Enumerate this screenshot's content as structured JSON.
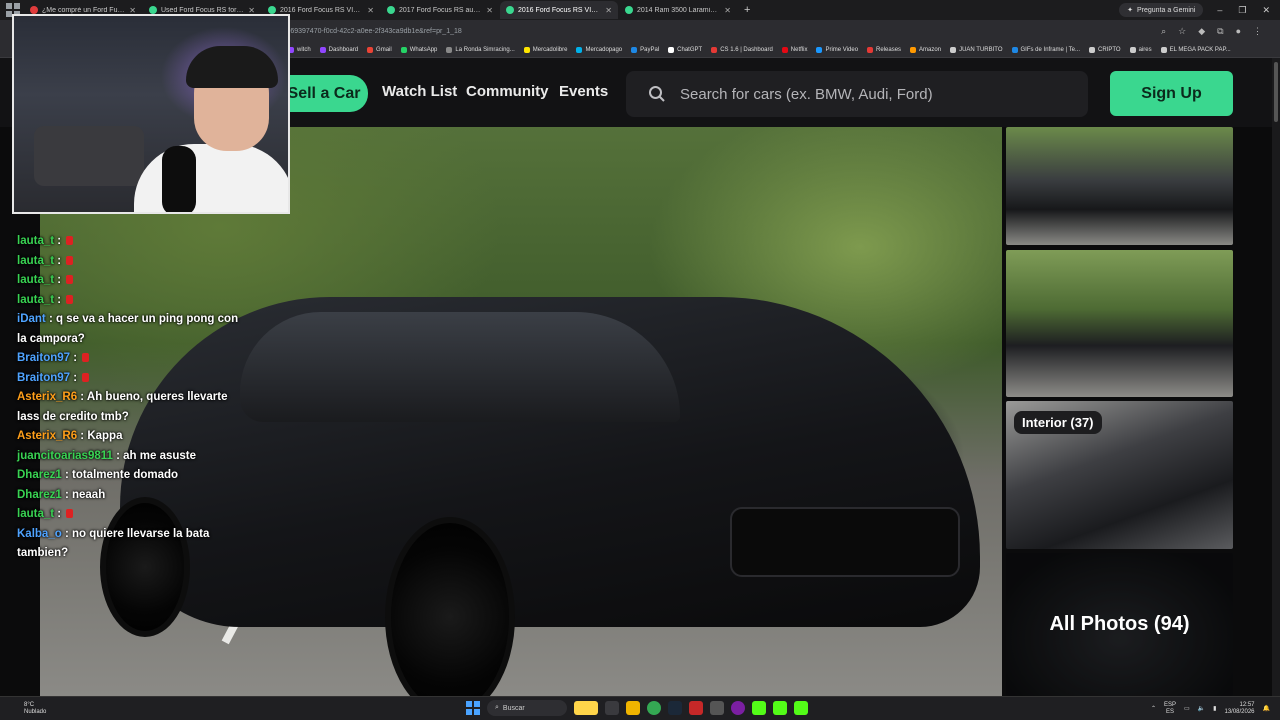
{
  "browser": {
    "tabs": [
      {
        "title": "¿Me compré un Ford Fusion Sp...",
        "color": "#e03c3c"
      },
      {
        "title": "Used Ford Focus RS for Sale -",
        "color": "#3ad78f"
      },
      {
        "title": "2016 Ford Focus RS VIN: WF0D...",
        "color": "#3ad78f"
      },
      {
        "title": "2017 Ford Focus RS auction - C...",
        "color": "#3ad78f"
      },
      {
        "title": "2016 Ford Focus RS VIN: WF0D...",
        "color": "#3ad78f",
        "active": true
      },
      {
        "title": "2014 Ram 3500 Laramie 4x4 V...",
        "color": "#3ad78f"
      }
    ],
    "new_tab": "+",
    "gemini": "Pregunta a Gemini",
    "url": "-69397470-f0cd-42c2-a0ee-2f343ca9db1e&ref=pr_1_18",
    "bookmarks": [
      {
        "label": "witch",
        "color": "#9146ff"
      },
      {
        "label": "Dashboard",
        "color": "#9146ff"
      },
      {
        "label": "Gmail",
        "color": "#ea4335"
      },
      {
        "label": "WhatsApp",
        "color": "#25d366"
      },
      {
        "label": "La Ronda Simracing...",
        "color": "#888888"
      },
      {
        "label": "Mercadolibre",
        "color": "#ffe600"
      },
      {
        "label": "Mercadopago",
        "color": "#00b1ea"
      },
      {
        "label": "PayPal",
        "color": "#1e88e5"
      },
      {
        "label": "ChatGPT",
        "color": "#ffffff"
      },
      {
        "label": "CS 1.6 | Dashboard",
        "color": "#e53935"
      },
      {
        "label": "Netflix",
        "color": "#e50914"
      },
      {
        "label": "Prime Video",
        "color": "#1a98ff"
      },
      {
        "label": "Releases",
        "color": "#e53935"
      },
      {
        "label": "Amazon",
        "color": "#ff9900"
      },
      {
        "label": "JUAN TURBITO",
        "color": "#cccccc"
      },
      {
        "label": "GIFs de Inframe | Te...",
        "color": "#1e88e5"
      },
      {
        "label": "CRIPTO",
        "color": "#cccccc"
      },
      {
        "label": "aires",
        "color": "#cccccc"
      },
      {
        "label": "EL MEGA PACK PAP...",
        "color": "#cccccc"
      }
    ]
  },
  "site": {
    "sell_button": "Sell a Car",
    "nav": [
      "Watch List",
      "Community",
      "Events"
    ],
    "search_placeholder": "Search for cars (ex. BMW, Audi, Ford)",
    "signup_button": "Sign Up",
    "interior_label": "Interior (37)",
    "all_photos_label": "All Photos (94)",
    "accent_color": "#3ad78f"
  },
  "chat": [
    {
      "user": "lauta_t",
      "color": "#39d353",
      "msg": ""
    },
    {
      "user": "lauta_t",
      "color": "#39d353",
      "msg": ""
    },
    {
      "user": "lauta_t",
      "color": "#39d353",
      "msg": ""
    },
    {
      "user": "lauta_t",
      "color": "#39d353",
      "msg": ""
    },
    {
      "user": "iDant",
      "color": "#4fa3ff",
      "msg": "q se va a hacer un ping pong con la campora?"
    },
    {
      "user": "Braiton97",
      "color": "#4fa3ff",
      "msg": ""
    },
    {
      "user": "Braiton97",
      "color": "#4fa3ff",
      "msg": ""
    },
    {
      "user": "Asterix_R6",
      "color": "#ff9f1a",
      "msg": "Ah bueno, queres llevarte lass de credito tmb?"
    },
    {
      "user": "Asterix_R6",
      "color": "#ff9f1a",
      "msg": "Kappa"
    },
    {
      "user": "juancitoarias9811",
      "color": "#39d353",
      "msg": "ah me asuste"
    },
    {
      "user": "Dharez1",
      "color": "#39d353",
      "msg": "totalmente domado"
    },
    {
      "user": "Dharez1",
      "color": "#39d353",
      "msg": "neaah"
    },
    {
      "user": "lauta_t",
      "color": "#39d353",
      "msg": ""
    },
    {
      "user": "Kalba_o",
      "color": "#4fa3ff",
      "msg": "no quiere llevarse la bata tambien?"
    }
  ],
  "taskbar": {
    "weather_temp": "8°C",
    "weather_desc": "Nublado",
    "search": "Buscar",
    "lang_top": "ESP",
    "lang_bottom": "ES",
    "time": "12:57",
    "date": "13/08/2026"
  }
}
